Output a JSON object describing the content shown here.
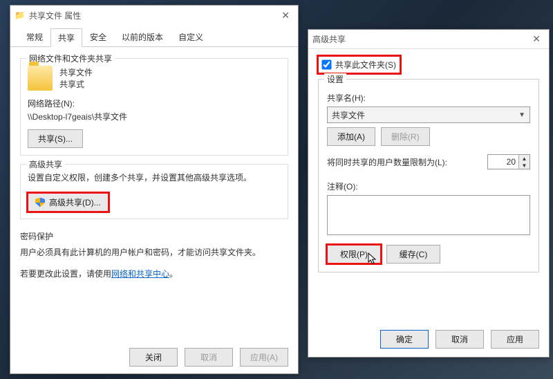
{
  "left": {
    "title": "共享文件 属性",
    "tabs": [
      "常规",
      "共享",
      "安全",
      "以前的版本",
      "自定义"
    ],
    "group1_title": "网络文件和文件夹共享",
    "folder_name": "共享文件",
    "share_state": "共享式",
    "netpath_label": "网络路径(N):",
    "netpath_value": "\\\\Desktop-l7geais\\共享文件",
    "share_btn": "共享(S)...",
    "group2_title": "高级共享",
    "adv_desc": "设置自定义权限，创建多个共享，并设置其他高级共享选项。",
    "adv_btn": "高级共享(D)...",
    "group3_title": "密码保护",
    "pw_line1": "用户必须具有此计算机的用户帐户和密码，才能访问共享文件夹。",
    "pw_line2_prefix": "若要更改此设置，请使用",
    "pw_link": "网络和共享中心",
    "pw_line2_suffix": "。",
    "close_btn": "关闭",
    "cancel_btn": "取消",
    "apply_btn": "应用(A)"
  },
  "right": {
    "title": "高级共享",
    "share_checkbox": "共享此文件夹(S)",
    "settings_legend": "设置",
    "sharename_label": "共享名(H):",
    "sharename_value": "共享文件",
    "add_btn": "添加(A)",
    "remove_btn": "删除(R)",
    "limit_label": "将同时共享的用户数量限制为(L):",
    "limit_value": "20",
    "comment_label": "注释(O):",
    "perm_btn": "权限(P)",
    "cache_btn": "缓存(C)",
    "ok_btn": "确定",
    "cancel_btn": "取消",
    "apply_btn": "应用"
  }
}
